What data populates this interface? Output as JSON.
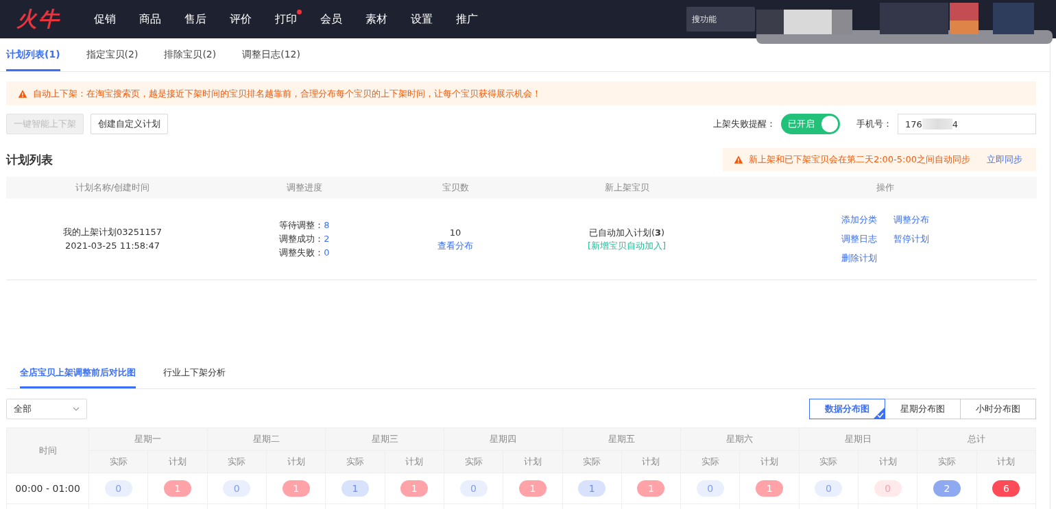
{
  "topbar": {
    "logo": "火牛",
    "nav": [
      {
        "label": "促销",
        "dot": false
      },
      {
        "label": "商品",
        "dot": false
      },
      {
        "label": "售后",
        "dot": false
      },
      {
        "label": "评价",
        "dot": false
      },
      {
        "label": "打印",
        "dot": true
      },
      {
        "label": "会员",
        "dot": false
      },
      {
        "label": "素材",
        "dot": false
      },
      {
        "label": "设置",
        "dot": false
      },
      {
        "label": "推广",
        "dot": false
      }
    ],
    "search": {
      "placeholder": "搜功能"
    }
  },
  "tabs": [
    {
      "label": "计划列表(1)",
      "selected": true
    },
    {
      "label": "指定宝贝(2)",
      "selected": false
    },
    {
      "label": "排除宝贝(2)",
      "selected": false
    },
    {
      "label": "调整日志(12)",
      "selected": false
    }
  ],
  "alert": "自动上下架：在淘宝搜索页，越是接近下架时间的宝贝排名越靠前，合理分布每个宝贝的上下架时间，让每个宝贝获得展示机会！",
  "actions": [
    {
      "label": "一键智能上下架",
      "disabled": true
    },
    {
      "label": "创建自定义计划",
      "disabled": false
    }
  ],
  "reminder": {
    "label": "上架失败提醒：",
    "toggle": {
      "on": true,
      "text": "已开启"
    },
    "phone_label": "手机号：",
    "phone_prefix": "176",
    "phone_suffix": "4"
  },
  "plan_section": {
    "title": "计划列表",
    "notice": "新上架和已下架宝贝会在第二天2:00-5:00之间自动同步",
    "notice_link": "立即同步"
  },
  "plan_table": {
    "columns": [
      "计划名称/创建时间",
      "调整进度",
      "宝贝数",
      "新上架宝贝",
      "操作"
    ],
    "rows": [
      {
        "name": "我的上架计划03251157",
        "created": "2021-03-25 11:58:47",
        "progress": [
          {
            "label": "等待调整：",
            "value": "8"
          },
          {
            "label": "调整成功：",
            "value": "2"
          },
          {
            "label": "调整失败：",
            "value": "0"
          }
        ],
        "count": "10",
        "count_link": "查看分布",
        "new_items": "已自动加入计划(**3**)",
        "new_items_tag": "[新增宝贝自动加入]",
        "operations": [
          "添加分类",
          "调整分布",
          "调整日志",
          "暂停计划",
          "删除计划"
        ]
      }
    ]
  },
  "analysis_tabs": [
    {
      "label": "全店宝贝上架调整前后对比图",
      "selected": true
    },
    {
      "label": "行业上下架分析",
      "selected": false
    }
  ],
  "filter": {
    "value": "全部"
  },
  "chart_modes": [
    {
      "label": "数据分布图",
      "selected": true
    },
    {
      "label": "星期分布图",
      "selected": false
    },
    {
      "label": "小时分布图",
      "selected": false
    }
  ],
  "week_table": {
    "time_header": "时间",
    "groups": [
      {
        "label": "星期一",
        "sub_headers": [
          "实际",
          "计划"
        ]
      },
      {
        "label": "星期二",
        "sub_headers": [
          "实际",
          "计划"
        ]
      },
      {
        "label": "星期三",
        "sub_headers": [
          "实际",
          "计划"
        ]
      },
      {
        "label": "星期四",
        "sub_headers": [
          "实际",
          "计划"
        ]
      },
      {
        "label": "星期五",
        "sub_headers": [
          "实际",
          "计划"
        ]
      },
      {
        "label": "星期六",
        "sub_headers": [
          "实际",
          "计划"
        ]
      },
      {
        "label": "星期日",
        "sub_headers": [
          "实际",
          "计划"
        ]
      },
      {
        "label": "总计",
        "sub_headers": [
          "实际",
          "计划"
        ]
      }
    ],
    "rows": [
      {
        "time": "00:00 - 01:00",
        "cells": [
          {
            "kind": "actual-light",
            "value": "0"
          },
          {
            "kind": "plan",
            "value": "1"
          },
          {
            "kind": "actual-light",
            "value": "0"
          },
          {
            "kind": "plan",
            "value": "1"
          },
          {
            "kind": "actual",
            "value": "1"
          },
          {
            "kind": "plan",
            "value": "1"
          },
          {
            "kind": "actual-light",
            "value": "0"
          },
          {
            "kind": "plan",
            "value": "1"
          },
          {
            "kind": "actual",
            "value": "1"
          },
          {
            "kind": "plan",
            "value": "1"
          },
          {
            "kind": "actual-light",
            "value": "0"
          },
          {
            "kind": "plan",
            "value": "1"
          },
          {
            "kind": "actual-light",
            "value": "0"
          },
          {
            "kind": "plan-light",
            "value": "0"
          },
          {
            "kind": "actual-strong",
            "value": "2"
          },
          {
            "kind": "plan-strong",
            "value": "6"
          }
        ]
      }
    ]
  }
}
